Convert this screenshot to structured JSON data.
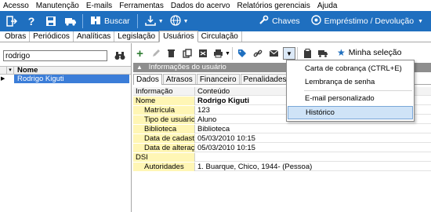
{
  "menu": [
    "Acesso",
    "Manutenção",
    "E-mails",
    "Ferramentas",
    "Dados do acervo",
    "Relatórios gerenciais",
    "Ajuda"
  ],
  "toolbar": {
    "buscar": "Buscar",
    "chaves": "Chaves",
    "emprestimo": "Empréstimo / Devolução"
  },
  "tabs": [
    "Obras",
    "Periódicos",
    "Analíticas",
    "Legislação",
    "Usuários",
    "Circulação"
  ],
  "active_tab": "Usuários",
  "left": {
    "search_value": "rodrigo",
    "column_header": "Nome",
    "rows": [
      "Rodrigo Kiguti"
    ]
  },
  "actions": {
    "minha_selecao": "Minha seleção"
  },
  "info_header": "Informações do usuário",
  "subtabs": [
    "Dados",
    "Atrasos",
    "Financeiro",
    "Penalidades alternativ"
  ],
  "grid": {
    "col_info": "Informação",
    "col_conteudo": "Conteúdo",
    "nome_label": "Nome",
    "nome_value": "Rodrigo Kiguti",
    "fields": [
      {
        "label": "Matrícula",
        "value": "123"
      },
      {
        "label": "Tipo de usuário",
        "value": "Aluno"
      },
      {
        "label": "Biblioteca",
        "value": "Biblioteca"
      },
      {
        "label": "Data de cadastro",
        "value": "05/03/2010 10:15"
      },
      {
        "label": "Data de alteração",
        "value": "05/03/2010 10:15"
      }
    ],
    "dsi_label": "DSI",
    "autoridades_label": "Autoridades",
    "autoridades_value": "1. Buarque, Chico, 1944- (Pessoa)"
  },
  "dropdown": {
    "items": [
      "Carta de cobrança (CTRL+E)",
      "Lembrança de senha",
      "E-mail personalizado",
      "Histórico"
    ],
    "highlighted": "Histórico"
  },
  "colors": {
    "toolbar_blue": "#1f6fbf",
    "selection_blue": "#3b7dd8",
    "field_yellow": "#fff6b5",
    "menu_highlight": "#cfe3f7"
  },
  "icons": [
    "logout-icon",
    "help-icon",
    "save-icon",
    "truck-icon",
    "buscar-icon",
    "download-icon",
    "globe-icon",
    "wrench-icon",
    "loan-icon",
    "binoculars-icon",
    "add-icon",
    "edit-icon",
    "delete-icon",
    "copy-icon",
    "export-icon",
    "print-icon",
    "tag-icon",
    "link-icon",
    "email-icon",
    "clipboard-icon",
    "truck-icon",
    "star-icon"
  ]
}
